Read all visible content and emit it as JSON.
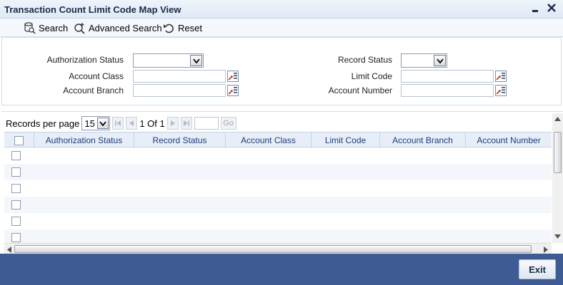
{
  "window": {
    "title": "Transaction Count Limit Code Map View",
    "minimize_icon": "minimize-icon",
    "close_icon": "close-icon"
  },
  "toolbar": {
    "search_label": "Search",
    "advanced_search_label": "Advanced Search",
    "reset_label": "Reset"
  },
  "form": {
    "authorization_status_label": "Authorization Status",
    "authorization_status_value": "",
    "record_status_label": "Record Status",
    "record_status_value": "",
    "account_class_label": "Account Class",
    "account_class_value": "",
    "limit_code_label": "Limit Code",
    "limit_code_value": "",
    "account_branch_label": "Account Branch",
    "account_branch_value": "",
    "account_number_label": "Account Number",
    "account_number_value": ""
  },
  "pager": {
    "records_per_page_label": "Records per page",
    "records_per_page_value": "15",
    "page_info": "1 Of 1",
    "go_label": "Go"
  },
  "table": {
    "columns": [
      "Authorization Status",
      "Record Status",
      "Account Class",
      "Limit Code",
      "Account Branch",
      "Account Number"
    ],
    "visible_rows": 6
  },
  "footer": {
    "exit_label": "Exit"
  },
  "colors": {
    "header_text": "#1f3a77",
    "footer_bg": "#3f5b94",
    "lov_icon": "#c0392b"
  }
}
